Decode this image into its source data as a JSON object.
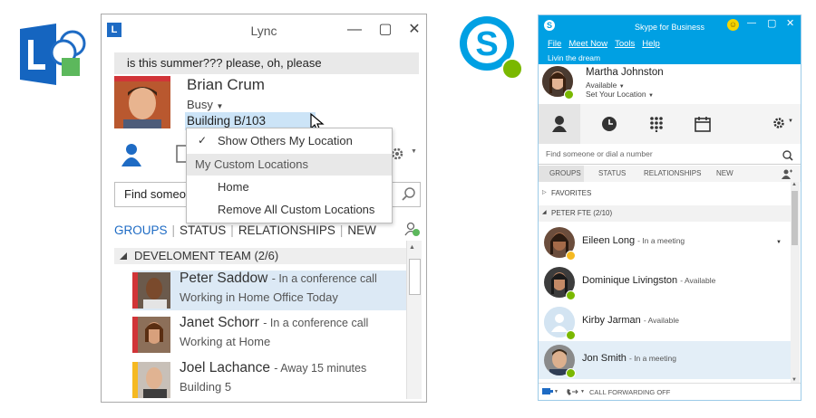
{
  "lync": {
    "window_title": "Lync",
    "note": "is this summer??? please, oh, please",
    "user": {
      "name": "Brian Crum",
      "status": "Busy",
      "location": "Building B/103"
    },
    "search_placeholder": "Find someone",
    "tabs": [
      "GROUPS",
      "STATUS",
      "RELATIONSHIPS",
      "NEW"
    ],
    "group_header": "DEVELOMENT TEAM (2/6)",
    "contacts": [
      {
        "name": "Peter Saddow",
        "activity": "In a conference call",
        "note": "Working in Home Office Today",
        "selected": true
      },
      {
        "name": "Janet Schorr",
        "activity": "In a conference call",
        "note": "Working at Home",
        "selected": false
      },
      {
        "name": "Joel Lachance",
        "activity": "Away 15 minutes",
        "note": "Building 5",
        "selected": false
      }
    ],
    "location_menu": {
      "show_others": "Show Others My Location",
      "custom_header": "My Custom Locations",
      "home": "Home",
      "remove_all": "Remove All Custom Locations"
    },
    "colors": {
      "accent": "#1e6bc4",
      "busy": "#d13438",
      "selected": "#dce9f5"
    }
  },
  "skype": {
    "window_title": "Skype for Business",
    "menu": [
      "File",
      "Meet Now",
      "Tools",
      "Help"
    ],
    "note": "Livin the dream",
    "user": {
      "name": "Martha Johnston",
      "status": "Available",
      "location": "Set Your Location"
    },
    "search_placeholder": "Find someone or dial a number",
    "tabs": [
      "GROUPS",
      "STATUS",
      "RELATIONSHIPS",
      "NEW"
    ],
    "sections": [
      "FAVORITES",
      "PETER FTE (2/10)"
    ],
    "contacts": [
      {
        "name": "Eileen Long",
        "activity": "In a meeting",
        "presence": "busy"
      },
      {
        "name": "Dominique Livingston",
        "activity": "Available",
        "presence": "available"
      },
      {
        "name": "Kirby Jarman",
        "activity": "Available",
        "presence": "available"
      },
      {
        "name": "Jon Smith",
        "activity": "In a meeting",
        "presence": "busy",
        "selected": true
      }
    ],
    "footer": "CALL FORWARDING OFF",
    "colors": {
      "brand": "#00a0e3",
      "available": "#7ab800",
      "away": "#f5b921"
    }
  }
}
